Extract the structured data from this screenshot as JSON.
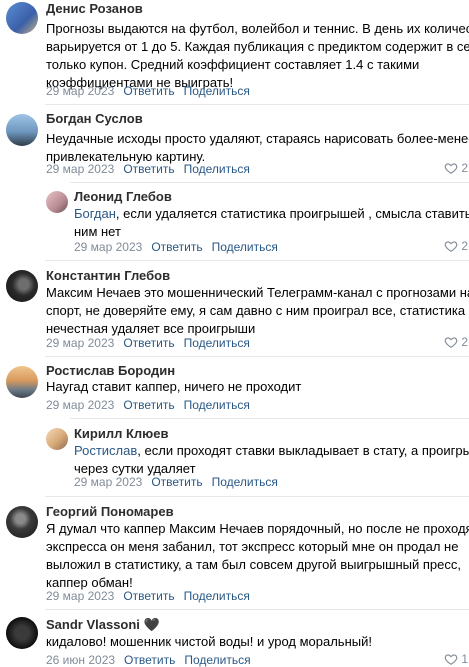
{
  "comments": [
    {
      "author": "Денис Розанов",
      "lines": [
        "Прогнозы выдаются на футбол, волейбол и теннис. В день их количество",
        "варьируется от 1 до 5. Каждая публикация с предиктом содержит в себе",
        "только купон. Средний коэффициент составляет 1.4 с такими",
        "коэффициентами не выиграть!"
      ],
      "date": "29 мар 2023",
      "reply": "Ответить",
      "share": "Поделиться",
      "likes": ""
    },
    {
      "author": "Богдан Суслов",
      "lines": [
        "Неудачные исходы просто удаляют, стараясь нарисовать более-менее",
        "привлекательную картину."
      ],
      "date": "29 мар 2023",
      "reply": "Ответить",
      "share": "Поделиться",
      "likes": "2"
    },
    {
      "author": "Леонид Глебов",
      "mention": "Богдан",
      "lines": [
        ", если удаляется статистика проигрышей , смысла ставить с",
        "ним нет"
      ],
      "date": "29 мар 2023",
      "reply": "Ответить",
      "share": "Поделиться",
      "likes": "2"
    },
    {
      "author": "Константин Глебов",
      "lines": [
        "Максим Нечаев это мошеннический Телеграмм-канал с прогнозами на",
        "спорт, не доверяйте ему, я сам давно с ним проиграл все, статистика",
        "нечестная удаляет все проигрыши"
      ],
      "date": "29 мар 2023",
      "reply": "Ответить",
      "share": "Поделиться",
      "likes": "2"
    },
    {
      "author": "Ростислав Бородин",
      "lines": [
        "Наугад ставит каппер, ничего не проходит"
      ],
      "date": "29 мар 2023",
      "reply": "Ответить",
      "share": "Поделиться",
      "likes": ""
    },
    {
      "author": "Кирилл Клюев",
      "mention": "Ростислав",
      "lines": [
        ", если проходят ставки выкладывает в стату, а проигрыши",
        "через сутки удаляет"
      ],
      "date": "29 мар 2023",
      "reply": "Ответить",
      "share": "Поделиться",
      "likes": ""
    },
    {
      "author": "Георгий Пономарев",
      "lines": [
        "Я думал что каппер Максим Нечаев порядочный, но после не проходя",
        "экспресса он меня забанил, тот экспресс который мне он продал не",
        "выложил в статистику, а там был совсем другой выигрышный пресс,",
        "каппер обман!"
      ],
      "date": "29 мар 2023",
      "reply": "Ответить",
      "share": "Поделиться",
      "likes": ""
    },
    {
      "author": "Sandr Vlassoni",
      "author_emoji": "🖤",
      "lines": [
        "кидалово! мошенник чистой воды! и урод моральный!"
      ],
      "date": "26 июн 2023",
      "reply": "Ответить",
      "share": "Поделиться",
      "likes": "1"
    }
  ]
}
